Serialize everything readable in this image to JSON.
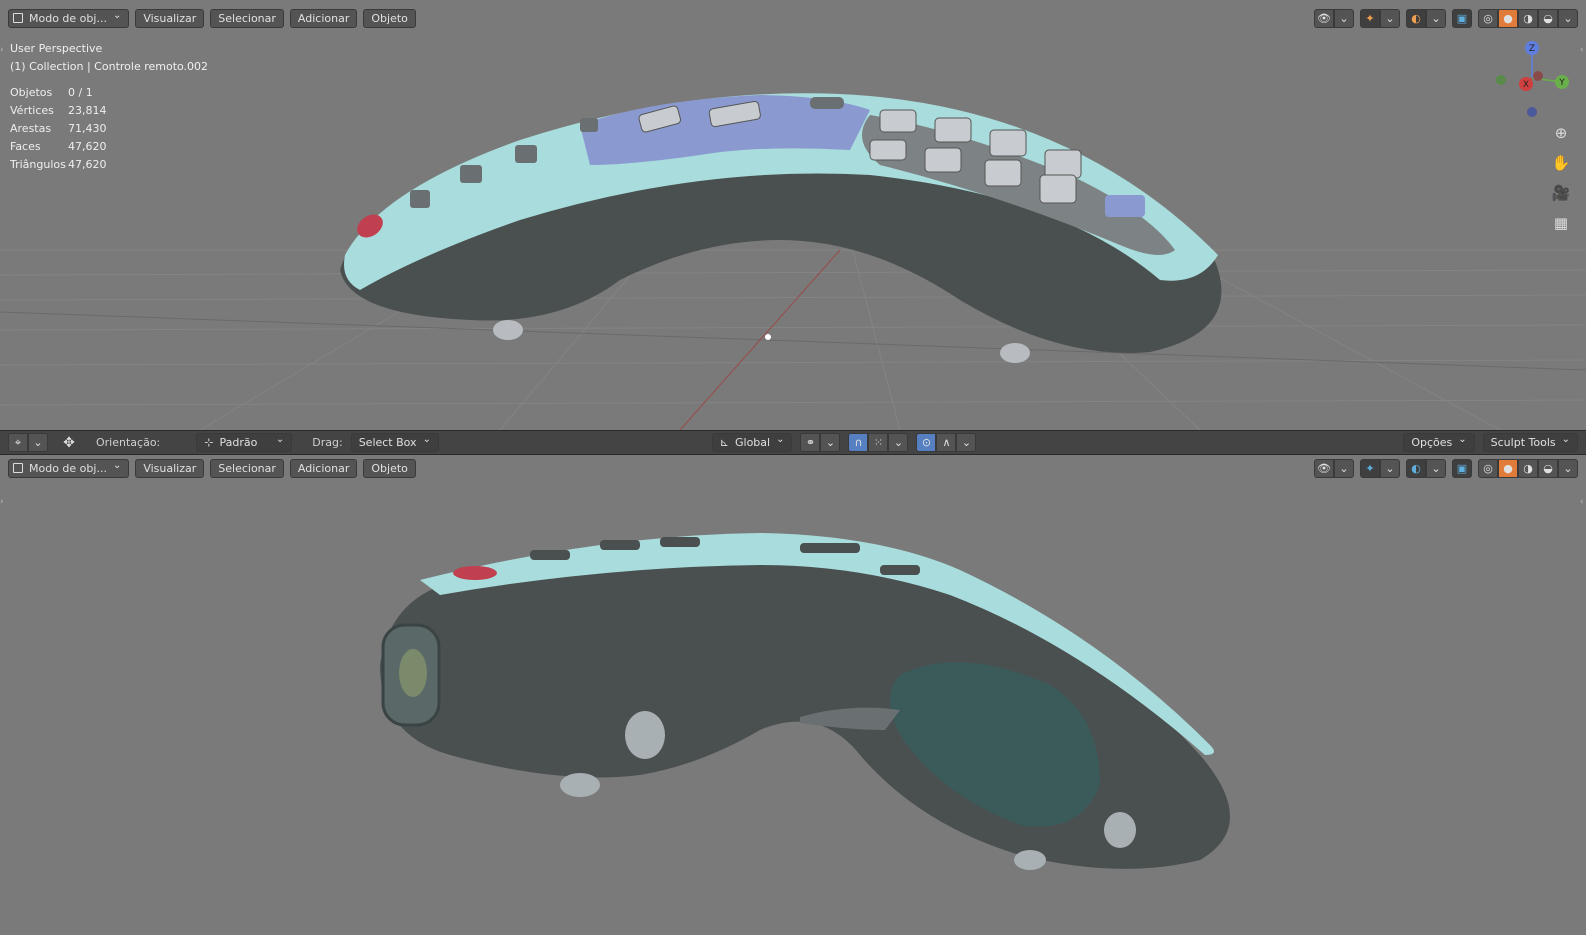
{
  "top_viewport": {
    "header": {
      "mode_label": "Modo de obj...",
      "menus": [
        "Visualizar",
        "Selecionar",
        "Adicionar",
        "Objeto"
      ]
    },
    "view_name": "User Perspective",
    "collection": "(1) Collection | Controle remoto.002",
    "stats": [
      {
        "label": "Objetos",
        "value": "0 / 1"
      },
      {
        "label": "Vértices",
        "value": "23,814"
      },
      {
        "label": "Arestas",
        "value": "71,430"
      },
      {
        "label": "Faces",
        "value": "47,620"
      },
      {
        "label": "Triângulos",
        "value": "47,620"
      }
    ],
    "gizmo_axes": {
      "z": "Z",
      "y": "Y",
      "x": "X"
    }
  },
  "toolbar": {
    "orientation_label": "Orientação:",
    "orientation_value": "Padrão",
    "drag_label": "Drag:",
    "drag_value": "Select Box",
    "transform_value": "Global",
    "options_label": "Opções",
    "sculpt_label": "Sculpt Tools"
  },
  "bottom_viewport": {
    "header": {
      "mode_label": "Modo de obj...",
      "menus": [
        "Visualizar",
        "Selecionar",
        "Adicionar",
        "Objeto"
      ]
    }
  },
  "colors": {
    "viewport_bg": "#7a7a7a",
    "remote_top": "#a9dcdc",
    "remote_body": "#4a5050",
    "button_gray": "#c8ccd0",
    "button_blue": "#8a9ad0",
    "button_red": "#c04050",
    "active_blue": "#5680c2"
  }
}
